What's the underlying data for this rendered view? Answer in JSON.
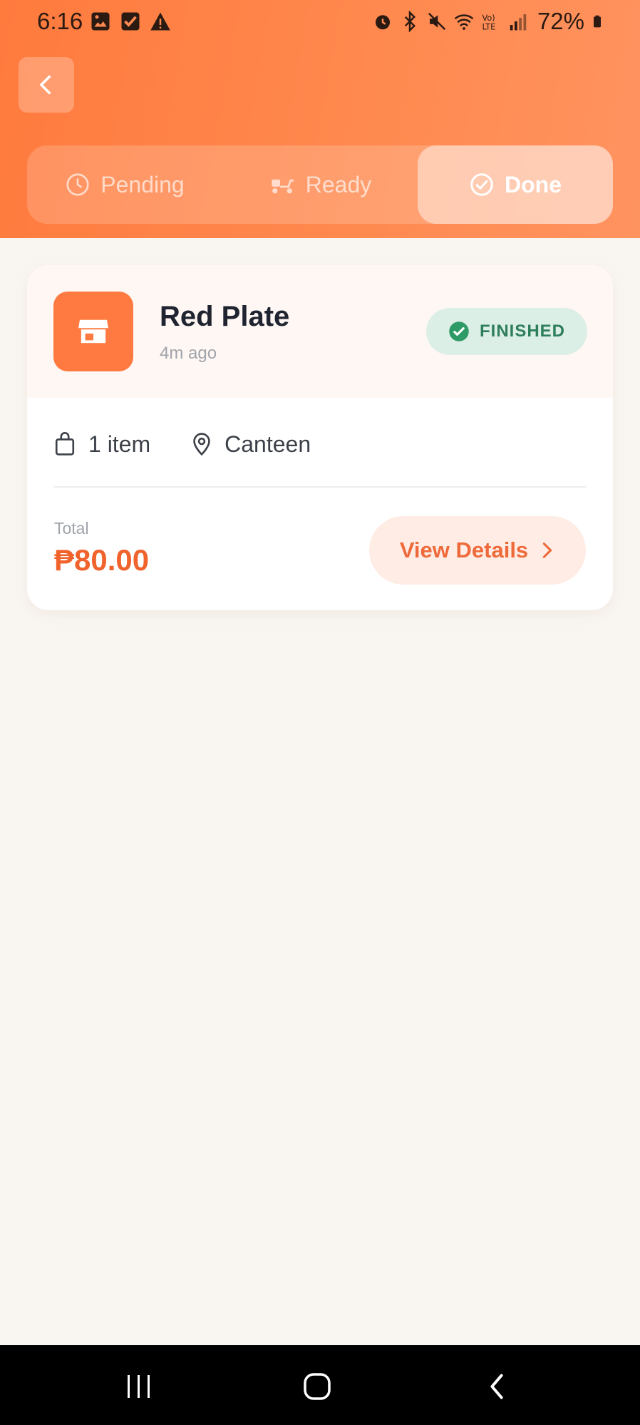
{
  "status_bar": {
    "time": "6:16",
    "battery": "72%",
    "left_icons": [
      "image-icon",
      "checkbox-icon",
      "warning-icon"
    ],
    "right_icons": [
      "alarm-icon",
      "bluetooth-icon",
      "mute-icon",
      "wifi-icon",
      "volte-icon",
      "signal-icon",
      "battery-icon"
    ]
  },
  "header": {
    "back_icon": "chevron-left-icon"
  },
  "tabs": [
    {
      "label": "Pending",
      "icon": "clock-icon",
      "active": false
    },
    {
      "label": "Ready",
      "icon": "scooter-icon",
      "active": false
    },
    {
      "label": "Done",
      "icon": "check-circle-icon",
      "active": true
    }
  ],
  "order": {
    "store_name": "Red Plate",
    "time_ago": "4m ago",
    "status": "FINISHED",
    "item_count": "1 item",
    "location": "Canteen",
    "total_label": "Total",
    "total_value": "₱80.00",
    "view_details": "View Details"
  },
  "colors": {
    "accent": "#ff7a3d",
    "price": "#f0632d",
    "finished_badge_bg": "#dcefe7",
    "finished_badge_text": "#2e7d5b"
  }
}
